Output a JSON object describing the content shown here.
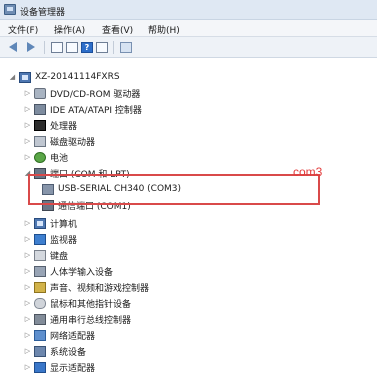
{
  "window": {
    "title": "设备管理器"
  },
  "menu": {
    "items": [
      "文件(F)",
      "操作(A)",
      "查看(V)",
      "帮助(H)"
    ]
  },
  "toolbar": {
    "buttons": [
      "back-icon",
      "forward-icon",
      "properties-icon",
      "help-icon",
      "scan-icon"
    ]
  },
  "tree": {
    "root": "XZ-20141114FXRS",
    "items": [
      {
        "label": "DVD/CD-ROM 驱动器",
        "icon": "disk-drive-icon"
      },
      {
        "label": "IDE ATA/ATAPI 控制器",
        "icon": "ide-controller-icon"
      },
      {
        "label": "处理器",
        "icon": "processor-icon"
      },
      {
        "label": "磁盘驱动器",
        "icon": "disk-icon"
      },
      {
        "label": "电池",
        "icon": "battery-icon"
      },
      {
        "label": "端口 (COM 和 LPT)",
        "icon": "port-icon"
      },
      {
        "label": "USB-SERIAL CH340 (COM3)",
        "icon": "usb-serial-icon"
      },
      {
        "label": "通信端口 (COM1)",
        "icon": "communication-port-icon"
      },
      {
        "label": "计算机",
        "icon": "computer-icon"
      },
      {
        "label": "监视器",
        "icon": "monitor-icon"
      },
      {
        "label": "键盘",
        "icon": "keyboard-icon"
      },
      {
        "label": "人体学输入设备",
        "icon": "hid-icon"
      },
      {
        "label": "声音、视频和游戏控制器",
        "icon": "audio-icon"
      },
      {
        "label": "鼠标和其他指针设备",
        "icon": "mouse-icon"
      },
      {
        "label": "通用串行总线控制器",
        "icon": "usb-controller-icon"
      },
      {
        "label": "网络适配器",
        "icon": "network-icon"
      },
      {
        "label": "系统设备",
        "icon": "system-icon"
      },
      {
        "label": "显示适配器",
        "icon": "display-adapter-icon"
      }
    ]
  },
  "annotation": {
    "text": "com3",
    "color": "#e23b3b"
  },
  "colors": {
    "highlight_border": "#d94a4a"
  }
}
